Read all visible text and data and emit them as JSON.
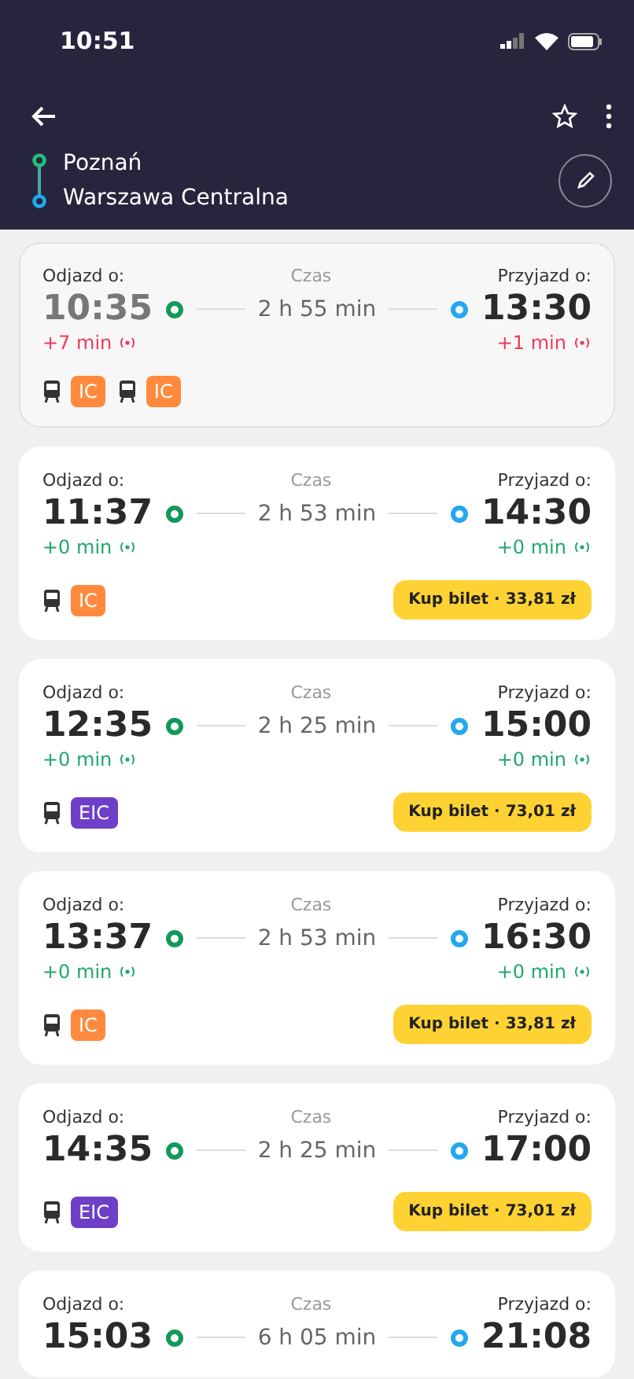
{
  "status_bar": {
    "time": "10:51"
  },
  "route": {
    "from": "Poznań",
    "to": "Warszawa Centralna"
  },
  "connections": [
    {
      "past": true,
      "departure_label": "Odjazd o:",
      "duration_label": "Czas",
      "arrival_label": "Przyjazd o:",
      "departure": "10:35",
      "duration": "2 h 55 min",
      "arrival": "13:30",
      "departure_delay": {
        "text": "+7 min",
        "late": true
      },
      "arrival_delay": {
        "text": "+1 min",
        "late": true
      },
      "trains": [
        {
          "category": "IC",
          "color": "#ff8a3d"
        },
        {
          "category": "IC",
          "color": "#ff8a3d"
        }
      ]
    },
    {
      "past": false,
      "departure_label": "Odjazd o:",
      "duration_label": "Czas",
      "arrival_label": "Przyjazd o:",
      "departure": "11:37",
      "duration": "2 h 53 min",
      "arrival": "14:30",
      "departure_delay": {
        "text": "+0 min",
        "late": false
      },
      "arrival_delay": {
        "text": "+0 min",
        "late": false
      },
      "trains": [
        {
          "category": "IC",
          "color": "#ff8a3d"
        }
      ],
      "ticket": "Kup bilet · 33,81 zł"
    },
    {
      "past": false,
      "departure_label": "Odjazd o:",
      "duration_label": "Czas",
      "arrival_label": "Przyjazd o:",
      "departure": "12:35",
      "duration": "2 h 25 min",
      "arrival": "15:00",
      "departure_delay": {
        "text": "+0 min",
        "late": false
      },
      "arrival_delay": {
        "text": "+0 min",
        "late": false
      },
      "trains": [
        {
          "category": "EIC",
          "color": "#6e3fc7"
        }
      ],
      "ticket": "Kup bilet · 73,01 zł"
    },
    {
      "past": false,
      "departure_label": "Odjazd o:",
      "duration_label": "Czas",
      "arrival_label": "Przyjazd o:",
      "departure": "13:37",
      "duration": "2 h 53 min",
      "arrival": "16:30",
      "departure_delay": {
        "text": "+0 min",
        "late": false
      },
      "arrival_delay": {
        "text": "+0 min",
        "late": false
      },
      "trains": [
        {
          "category": "IC",
          "color": "#ff8a3d"
        }
      ],
      "ticket": "Kup bilet · 33,81 zł"
    },
    {
      "past": false,
      "departure_label": "Odjazd o:",
      "duration_label": "Czas",
      "arrival_label": "Przyjazd o:",
      "departure": "14:35",
      "duration": "2 h 25 min",
      "arrival": "17:00",
      "trains": [
        {
          "category": "EIC",
          "color": "#6e3fc7"
        }
      ],
      "ticket": "Kup bilet · 73,01 zł"
    },
    {
      "past": false,
      "departure_label": "Odjazd o:",
      "duration_label": "Czas",
      "arrival_label": "Przyjazd o:",
      "departure": "15:03",
      "duration": "6 h 05 min",
      "arrival": "21:08"
    }
  ]
}
